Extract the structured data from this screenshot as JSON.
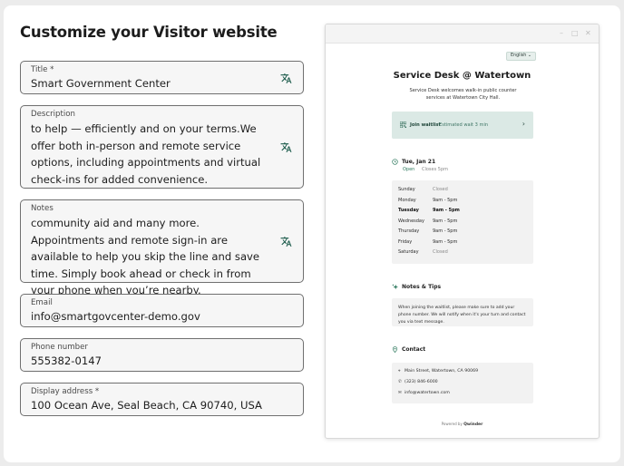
{
  "page": {
    "title": "Customize your Visitor website"
  },
  "form": {
    "title_label": "Title *",
    "title_value": "Smart Government Center",
    "description_label": "Description",
    "description_value": "to help — efficiently and on your terms.We offer both in-person and remote service options, including appointments and virtual check-ins for added convenience.",
    "notes_label": "Notes",
    "notes_value": "community aid and many more. Appointments and remote sign-in are available to help you skip the line and save time. Simply book ahead or check in from your phone when you’re nearby.",
    "email_label": "Email",
    "email_value": "info@smartgovcenter-demo.gov",
    "phone_label": "Phone number",
    "phone_value": "555382-0147",
    "address_label": "Display address *",
    "address_value": "100 Ocean Ave, Seal Beach, CA 90740, USA",
    "translate_icon": "translate-icon"
  },
  "preview": {
    "window_controls": [
      "–",
      "□",
      "✕"
    ],
    "language": "English ⌄",
    "title": "Service Desk @ Watertown",
    "subtitle": "Service Desk welcomes walk-in public counter services at Watertown City Hall.",
    "waitlist": {
      "label": "Join waitlist",
      "estimate": "Estimated wait 3 min",
      "chevron": "›"
    },
    "date_heading": "Tue, Jan 21",
    "open_status": "Open",
    "closes": "Closes 5pm",
    "hours": [
      {
        "day": "Sunday",
        "time": "Closed",
        "closed": true
      },
      {
        "day": "Monday",
        "time": "9am - 5pm"
      },
      {
        "day": "Tuesday",
        "time": "9am - 5pm",
        "today": true
      },
      {
        "day": "Wednesday",
        "time": "9am - 5pm"
      },
      {
        "day": "Thursday",
        "time": "9am - 5pm"
      },
      {
        "day": "Friday",
        "time": "9am - 5pm"
      },
      {
        "day": "Saturday",
        "time": "Closed",
        "closed": true
      }
    ],
    "notes_heading": "Notes & Tips",
    "notes_text": "When joining the waitlist, please make sure to add your phone number. We will notify when it's your turn and contact you via text message.",
    "contact_heading": "Contact",
    "contact": {
      "address": "Main Street, Watertown, CA 90069",
      "phone": "(323) 846-6000",
      "email": "info@watertown.com"
    },
    "powered_by": "Powered by",
    "brand": "Qwinder"
  },
  "colors": {
    "accent": "#2f7a5f",
    "waitlist_bg": "#dbe9e5",
    "field_border": "#6f6f6f"
  }
}
